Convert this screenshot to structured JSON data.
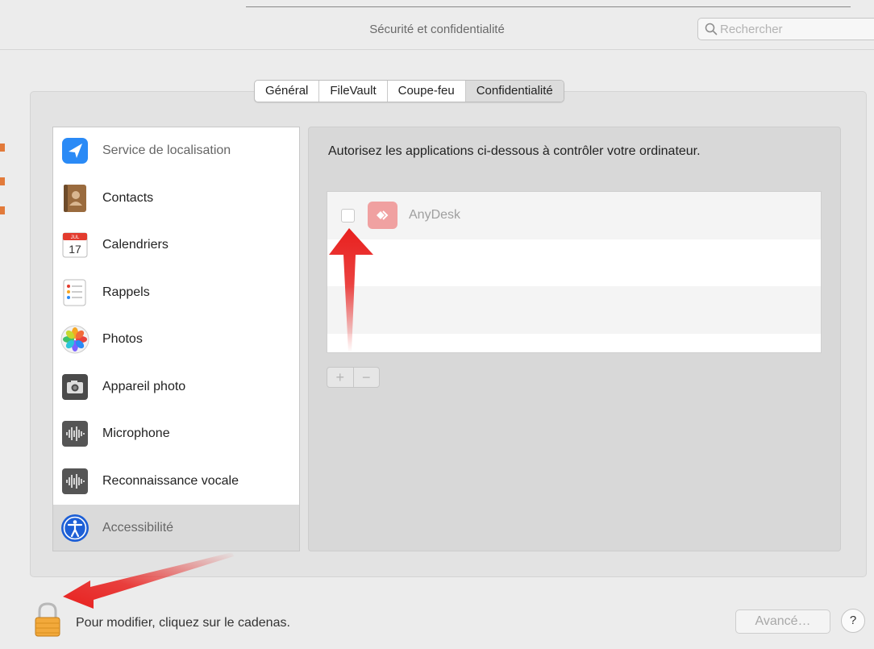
{
  "window": {
    "title": "Sécurité et confidentialité"
  },
  "search": {
    "placeholder": "Rechercher"
  },
  "tabs": [
    {
      "label": "Général"
    },
    {
      "label": "FileVault"
    },
    {
      "label": "Coupe-feu"
    },
    {
      "label": "Confidentialité",
      "selected": true
    }
  ],
  "sidebar": {
    "items": [
      {
        "label": "Service de localisation",
        "icon": "location-arrow-icon"
      },
      {
        "label": "Contacts",
        "icon": "contacts-book-icon"
      },
      {
        "label": "Calendriers",
        "icon": "calendar-icon",
        "calendar_month": "JUL",
        "calendar_day": "17"
      },
      {
        "label": "Rappels",
        "icon": "reminders-icon"
      },
      {
        "label": "Photos",
        "icon": "photos-flower-icon"
      },
      {
        "label": "Appareil photo",
        "icon": "camera-icon"
      },
      {
        "label": "Microphone",
        "icon": "microphone-waveform-icon"
      },
      {
        "label": "Reconnaissance vocale",
        "icon": "speech-waveform-icon"
      },
      {
        "label": "Accessibilité",
        "icon": "accessibility-icon",
        "selected": true
      }
    ]
  },
  "main": {
    "instruction": "Autorisez les applications ci-dessous à contrôler votre ordinateur.",
    "apps": [
      {
        "name": "AnyDesk",
        "checked": false,
        "icon": "anydesk-icon",
        "color": "#ef3b36"
      }
    ],
    "add_label": "+",
    "remove_label": "−"
  },
  "footer": {
    "lock_message": "Pour modifier, cliquez sur le cadenas.",
    "advanced_label": "Avancé…",
    "help_label": "?"
  },
  "annotations": {
    "arrow_color": "#e8201e"
  }
}
